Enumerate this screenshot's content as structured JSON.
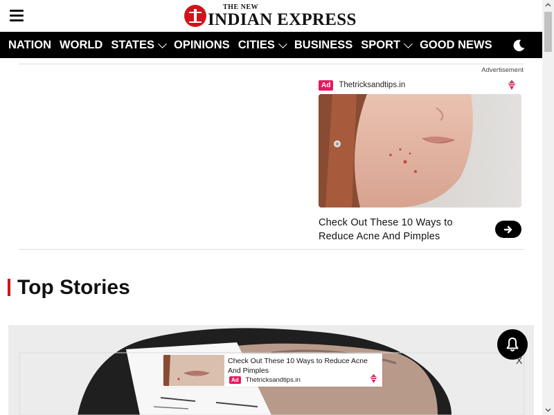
{
  "header": {
    "logo_small": "THE NEW",
    "logo_big": "INDIAN EXPRESS"
  },
  "nav": {
    "items": [
      {
        "label": "NATION",
        "has_dropdown": false
      },
      {
        "label": "WORLD",
        "has_dropdown": false
      },
      {
        "label": "STATES",
        "has_dropdown": true
      },
      {
        "label": "OPINIONS",
        "has_dropdown": false
      },
      {
        "label": "CITIES",
        "has_dropdown": true
      },
      {
        "label": "BUSINESS",
        "has_dropdown": false
      },
      {
        "label": "SPORT",
        "has_dropdown": true
      },
      {
        "label": "GOOD NEWS",
        "has_dropdown": false
      }
    ],
    "theme_toggle_icon": "moon-icon"
  },
  "ad": {
    "label": "Advertisement",
    "badge": "Ad",
    "source": "Thetricksandtips.in",
    "title": "Check Out These 10 Ways to Reduce Acne And Pimples"
  },
  "section": {
    "title": "Top Stories"
  },
  "sticky_ad": {
    "title": "Check Out These 10 Ways to Reduce Acne And Pimples",
    "badge": "Ad",
    "source": "Thetricksandtips.in",
    "close_label": "X"
  },
  "colors": {
    "brand_red": "#d3121b",
    "ad_badge": "#e5195f",
    "nav_bg": "#000000"
  }
}
